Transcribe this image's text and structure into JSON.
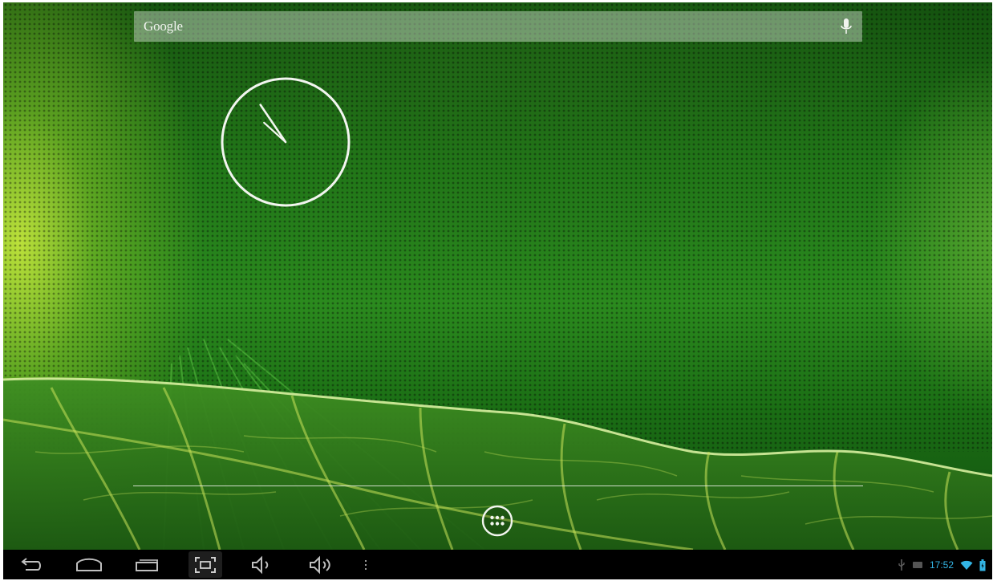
{
  "search": {
    "label": "Google",
    "icon": "mic-icon"
  },
  "clock_widget": {
    "type": "analog-clock",
    "hour": 10,
    "minute": 52
  },
  "home": {
    "app_drawer_icon": "grid-icon"
  },
  "navbar": {
    "buttons": [
      {
        "icon": "back-icon"
      },
      {
        "icon": "home-icon"
      },
      {
        "icon": "recent-apps-icon"
      },
      {
        "icon": "screenshot-icon"
      },
      {
        "icon": "volume-down-icon"
      },
      {
        "icon": "volume-up-icon"
      },
      {
        "icon": "menu-dots-icon"
      }
    ]
  },
  "status": {
    "time": "17:52",
    "icons": [
      "usb-icon",
      "notification-icon",
      "wifi-icon",
      "battery-icon"
    ],
    "accent_color": "#33b5e5"
  },
  "colors": {
    "wallpaper_green": "#1f7a18",
    "wallpaper_highlight": "#c4e63c",
    "navbar": "#000000"
  }
}
